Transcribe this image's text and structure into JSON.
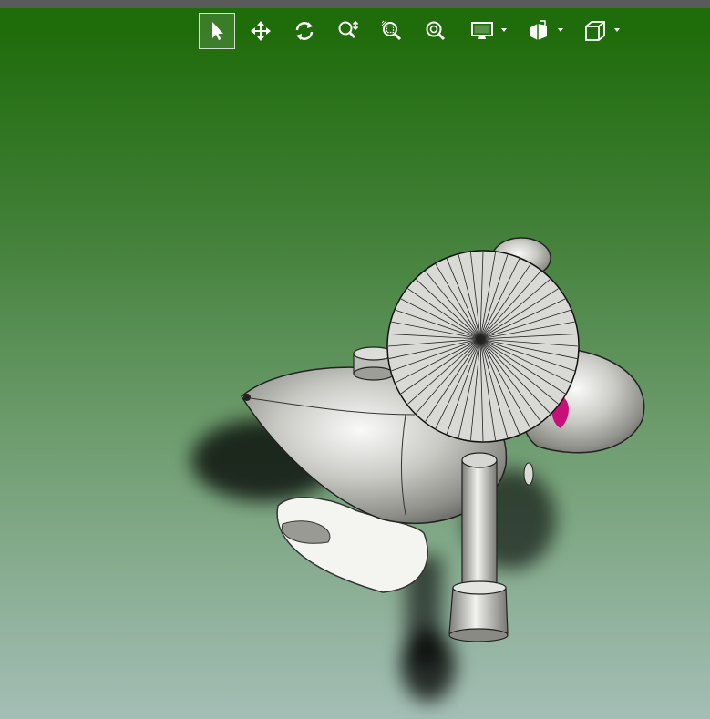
{
  "window": {
    "title": ""
  },
  "viewer": {
    "background_top": "#1f6c0a",
    "background_bottom": "#a4beb6",
    "accent_color": "#c8107a"
  },
  "toolbar": {
    "tools": [
      {
        "id": "select",
        "icon": "select-arrow-icon",
        "active": true
      },
      {
        "id": "pan",
        "icon": "pan-arrows-icon",
        "active": false
      },
      {
        "id": "rotate",
        "icon": "rotate-icon",
        "active": false
      },
      {
        "id": "zoom",
        "icon": "zoom-updown-icon",
        "active": false
      },
      {
        "id": "zoom-area",
        "icon": "zoom-area-icon",
        "active": false
      },
      {
        "id": "zoom-fit",
        "icon": "zoom-fit-icon",
        "active": false
      },
      {
        "id": "display",
        "icon": "monitor-icon",
        "active": false,
        "dropdown": true
      },
      {
        "id": "section",
        "icon": "section-view-icon",
        "active": false,
        "dropdown": true
      },
      {
        "id": "view-orientation",
        "icon": "cube-icon",
        "active": false,
        "dropdown": true
      }
    ]
  }
}
